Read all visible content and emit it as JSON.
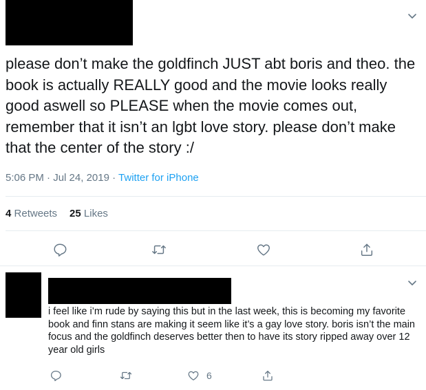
{
  "tweet": {
    "text": "please don’t make the goldfinch JUST abt boris and theo. the book is actually REALLY good and the movie looks really good aswell so PLEASE when the movie comes out, remember that it isn’t an lgbt love story. please don’t make that the center of the story :/",
    "time": "5:06 PM",
    "date": "Jul 24, 2019",
    "separator": "·",
    "source": "Twitter for iPhone",
    "retweets_count": "4",
    "retweets_label": "Retweets",
    "likes_count": "25",
    "likes_label": "Likes",
    "icons": {
      "more": "chevron-down-icon",
      "reply": "reply-icon",
      "retweet": "retweet-icon",
      "like": "heart-icon",
      "share": "share-icon"
    }
  },
  "reply": {
    "text": "i feel like i’m rude by saying this but in the last week, this is becoming my favorite book and finn stans are making it seem like it’s a gay love story. boris isn’t the main focus and the goldfinch deserves better then to have its story ripped away over 12 year old girls",
    "like_count": "6"
  },
  "colors": {
    "text": "#14171a",
    "secondary": "#657786",
    "link": "#1da1f2",
    "border": "#e6ecf0",
    "redaction": "#000000"
  }
}
